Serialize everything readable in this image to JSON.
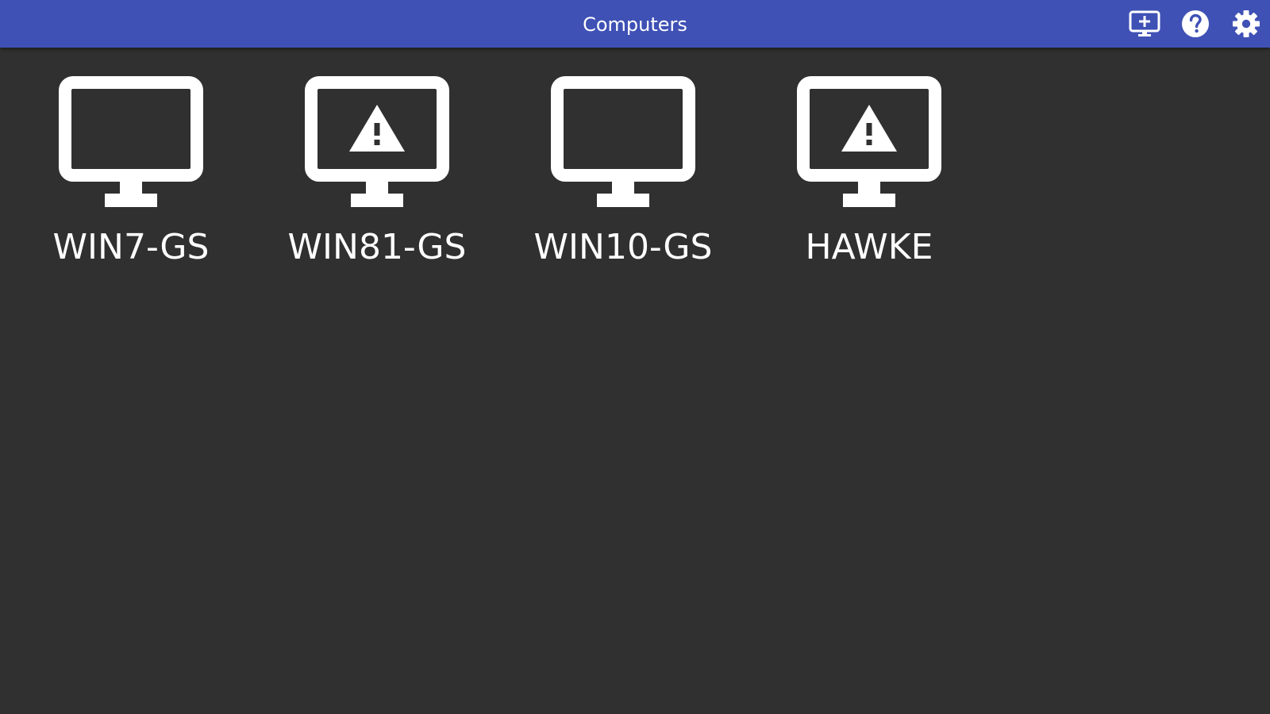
{
  "header": {
    "title": "Computers",
    "background_color": "#3f51b5",
    "actions": [
      {
        "icon": "add-computer-icon"
      },
      {
        "icon": "help-icon"
      },
      {
        "icon": "settings-icon"
      }
    ]
  },
  "computers": [
    {
      "name": "WIN7-GS",
      "icon": "monitor-icon",
      "warning": false
    },
    {
      "name": "WIN81-GS",
      "icon": "monitor-warning-icon",
      "warning": true
    },
    {
      "name": "WIN10-GS",
      "icon": "monitor-icon",
      "warning": false
    },
    {
      "name": "HAWKE",
      "icon": "monitor-warning-icon",
      "warning": true
    }
  ],
  "colors": {
    "background": "#303030",
    "icon": "#ffffff",
    "text": "#ffffff"
  }
}
